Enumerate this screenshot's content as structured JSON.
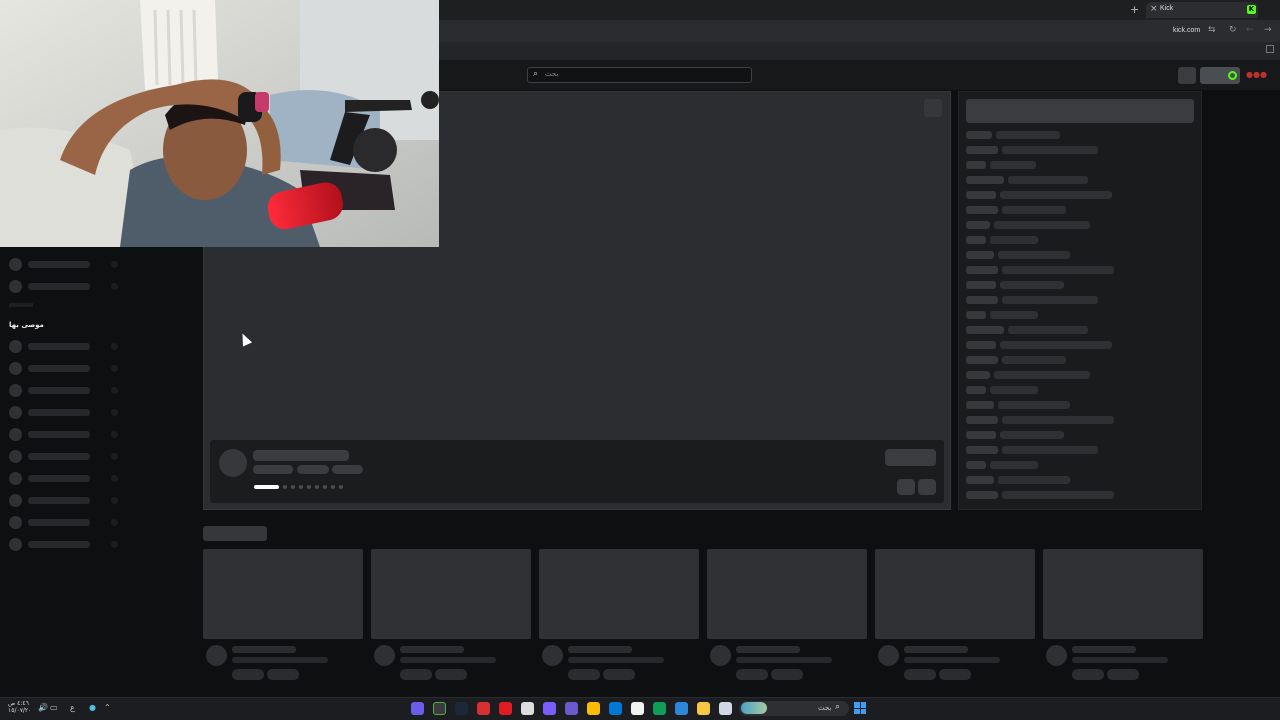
{
  "browser": {
    "tab_title": "Kick",
    "tab_close": "×",
    "new_tab": "+",
    "favicon_letter": "K",
    "url": "kick.com",
    "nav_icons": [
      "refresh-icon",
      "back-icon",
      "forward-icon"
    ]
  },
  "header": {
    "search_placeholder": "بحث",
    "search_icon": "⌕",
    "account_badge": "●●●"
  },
  "sidebar": {
    "section_heading": "موصى بها"
  },
  "taskbar": {
    "search_text": "بحث",
    "clock_time": "٤:٤٦ ص",
    "clock_date": "١٥/٠٧/٢٠",
    "lang": "ع",
    "colors": {
      "accent": "#53fc18",
      "windows": "#3aa0f5"
    }
  }
}
